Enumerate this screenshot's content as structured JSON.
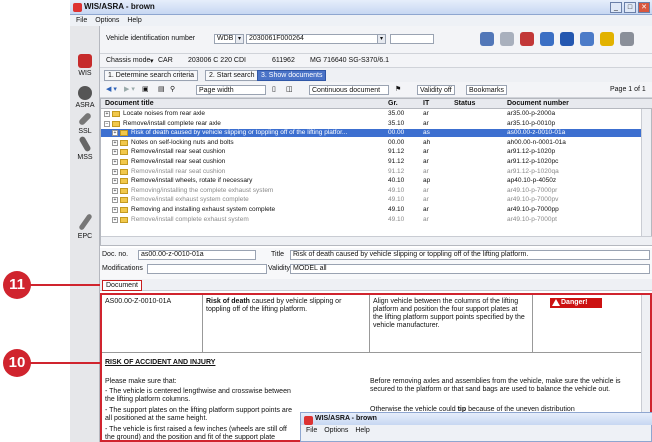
{
  "window": {
    "title": "WIS/ASRA - brown",
    "controls": [
      "_",
      "□",
      "✕"
    ]
  },
  "menu": [
    "File",
    "Options",
    "Help"
  ],
  "sidebar": [
    {
      "label": "WIS",
      "icon": "car-icon"
    },
    {
      "label": "ASRA",
      "icon": "clock-icon"
    },
    {
      "label": "SSL",
      "icon": "wrench-icon"
    },
    {
      "label": "MSS",
      "icon": "tools-icon"
    },
    {
      "label": "EPC",
      "icon": "screwdriver-icon"
    }
  ],
  "vin": {
    "label": "Vehicle identification number",
    "type": "WDB",
    "value": "2030061F000264"
  },
  "chassis": {
    "label": "Chassis mode",
    "items": [
      "CAR",
      "203006 C 220 CDI",
      "611962",
      "MG 716640 SG-S370/6.1"
    ]
  },
  "tabs": [
    "1. Determine search criteria",
    "2. Start search",
    "3. Show documents"
  ],
  "toolbar": {
    "zoom": "Page width",
    "view": "Continuous document",
    "validity": "Validity off",
    "bookmarks": "Bookmarks",
    "page": "Page 1 of 1"
  },
  "grid": {
    "headers": [
      "Document title",
      "Gr.",
      "IT",
      "Status",
      "Document number"
    ],
    "rows": [
      {
        "title": "Locate noises from rear axle",
        "gr": "35.00",
        "it": "ar",
        "status": "",
        "num": "ar35.00-p-2000a",
        "indent": 0,
        "style": "normal"
      },
      {
        "title": "Remove/install complete rear axle",
        "gr": "35.10",
        "it": "ar",
        "status": "",
        "num": "ar35.10-p-0010p",
        "indent": 0,
        "style": "normal"
      },
      {
        "title": "Risk of death caused by vehicle slipping or toppling off of the lifting platfor...",
        "gr": "00.00",
        "it": "as",
        "status": "",
        "num": "as00.00-z-0010-01a",
        "indent": 1,
        "style": "sel"
      },
      {
        "title": "Notes on self-locking nuts and bolts",
        "gr": "00.00",
        "it": "ah",
        "status": "",
        "num": "ah00.00-n-0001-01a",
        "indent": 1,
        "style": "normal"
      },
      {
        "title": "Remove/install rear seat cushion",
        "gr": "91.12",
        "it": "ar",
        "status": "",
        "num": "ar91.12-p-1020p",
        "indent": 1,
        "style": "normal"
      },
      {
        "title": "Remove/install rear seat cushion",
        "gr": "91.12",
        "it": "ar",
        "status": "",
        "num": "ar91.12-p-1020pc",
        "indent": 1,
        "style": "normal"
      },
      {
        "title": "Remove/install rear seat cushion",
        "gr": "91.12",
        "it": "ar",
        "status": "",
        "num": "ar91.12-p-1020qa",
        "indent": 1,
        "style": "gray"
      },
      {
        "title": "Remove/install wheels, rotate if necessary",
        "gr": "40.10",
        "it": "ap",
        "status": "",
        "num": "ap40.10-p-4050z",
        "indent": 1,
        "style": "normal"
      },
      {
        "title": "Removing/installing the complete exhaust system",
        "gr": "49.10",
        "it": "ar",
        "status": "",
        "num": "ar49.10-p-7000pr",
        "indent": 1,
        "style": "gray"
      },
      {
        "title": "Remove/install exhaust system complete",
        "gr": "49.10",
        "it": "ar",
        "status": "",
        "num": "ar49.10-p-7000pv",
        "indent": 1,
        "style": "gray"
      },
      {
        "title": "Removing and installing exhaust system complete",
        "gr": "49.10",
        "it": "ar",
        "status": "",
        "num": "ar49.10-p-7000pp",
        "indent": 1,
        "style": "normal"
      },
      {
        "title": "Remove/install complete exhaust system",
        "gr": "49.10",
        "it": "ar",
        "status": "",
        "num": "ar49.10-p-7000pt",
        "indent": 1,
        "style": "gray"
      }
    ]
  },
  "fields": {
    "docno_label": "Doc. no.",
    "docno": "as00.00-z-0010-01a",
    "title_label": "Title",
    "title": "Risk of death caused by vehicle slipping or toppling off of the lifting platform.",
    "mod_label": "Modifications",
    "validity_label": "Validity",
    "validity": "MODEL all"
  },
  "doc": {
    "tab": "Document",
    "code": "AS00.00-Z-0010-01A",
    "risk_bold": "Risk of death",
    "risk_text": "caused by vehicle slipping or toppling off of the lifting platform.",
    "align": "Align vehicle between the columns of the lifting platform and position the four support plates at the lifting platform support points specified by the vehicle manufacturer.",
    "danger": "Danger!",
    "heading": "RISK OF ACCIDENT AND INJURY",
    "intro": "Please make sure that:",
    "bullets": [
      "The vehicle is centered lengthwise and crosswise between the lifting platform columns.",
      "The support plates on the lifting platform support points are all positioned at the same height.",
      "The vehicle is first raised a few inches (wheels are still off the ground) and the position and fit of the support plate"
    ],
    "right1": "Before removing axles and assemblies from the vehicle, make sure the vehicle is secured to the platform or that sand bags are used to balance the vehicle out.",
    "right2a": "Otherwise the vehicle could",
    "right2b": "tip",
    "right2c": "because of the uneven distribution"
  },
  "callouts": [
    "11",
    "10"
  ],
  "popup": {
    "title": "WIS/ASRA - brown",
    "menu": [
      "File",
      "Options",
      "Help"
    ]
  }
}
